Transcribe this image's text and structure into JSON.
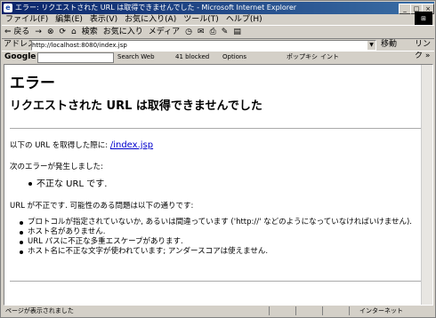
{
  "window": {
    "title": "エラー: リクエストされた URL は取得できませんでした - Microsoft Internet Explorer",
    "ie_letter": "e",
    "min_symbol": "_",
    "max_symbol": "□",
    "close_symbol": "×"
  },
  "menu": {
    "items": [
      "ファイル(F)",
      "編集(E)",
      "表示(V)",
      "お気に入り(A)",
      "ツール(T)",
      "ヘルプ(H)"
    ]
  },
  "toolbar": {
    "back": "⇐ 戻る",
    "forward": "→",
    "stop_icon": "⊗",
    "refresh_icon": "⟳",
    "home_icon": "⌂",
    "search": "検索",
    "favorites": "お気に入り",
    "media": "メディア",
    "history_icon": "◷",
    "mail_icon": "✉",
    "print_icon": "⎙",
    "edit_icon": "✎",
    "discuss_icon": "▤"
  },
  "address": {
    "label": "アドレス(D)",
    "url": "http://localhost:8080/index.jsp",
    "go": "移動",
    "links": "リンク »"
  },
  "google_bar": {
    "logo": "Google",
    "search_web": "Search Web",
    "blocked": "41 blocked",
    "options": "Options",
    "pop_label": "ポップキシ",
    "i_label": "イント"
  },
  "page": {
    "heading": "エラー",
    "subheading": "リクエストされた URL は取得できませんでした",
    "p1_prefix": "以下の URL を取得した際に: ",
    "p1_link": "/index.jsp",
    "p2": "次のエラーが発生しました:",
    "error_item": "不正な URL です.",
    "p3": "URL が不正です. 可能性のある問題は以下の通りです:",
    "problems": [
      "プロトコルが指定されていないか, あるいは間違っています ('http://' などのようになっていなければいけません).",
      "ホスト名がありません.",
      "URL パスに不正な多重エスケープがあります.",
      "ホスト名に不正な文字が使われています; アンダースコアは使えません."
    ]
  },
  "status": {
    "text": "ページが表示されました",
    "zone": "インターネット"
  }
}
